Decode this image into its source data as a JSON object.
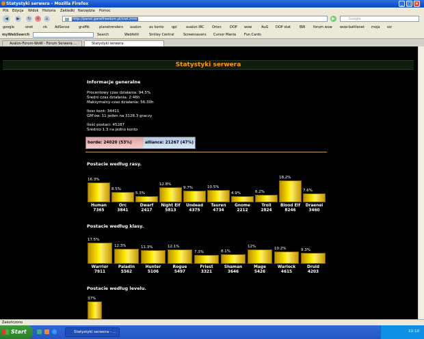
{
  "window": {
    "title": "Statystyki serwera - Mozilla Firefox"
  },
  "menu": [
    "Plik",
    "Edycja",
    "Widok",
    "Historia",
    "Zakładki",
    "Narzędzia",
    "Pomoc"
  ],
  "nav": {
    "url": "http://panel.ganefreedom.pl/stat.html",
    "search_placeholder": "Google"
  },
  "bookmarks": [
    "google",
    "onet",
    "nk",
    "AdSense",
    "graffik",
    "planetrenders",
    "avalon",
    "av konto",
    "qpl",
    "avalon IRC",
    "Orion",
    "DOP",
    "wow",
    "AuG",
    "DOP stat",
    "BW",
    "forum wow",
    "wow-battlenet",
    "moja",
    "ssr"
  ],
  "toolbar": {
    "brand": "myWebSearch",
    "items": [
      "Search",
      "Webfetti",
      "Smiley Central",
      "Screensavers",
      "Cursor Mania",
      "Fun Cards"
    ]
  },
  "tabs": [
    {
      "label": "Avalon-Forum-WoW - Forum Serwera ...",
      "active": false
    },
    {
      "label": "Statystyki serwera",
      "active": true
    }
  ],
  "page": {
    "header": "Statystyki serwera",
    "general_title": "Informacje generalne",
    "stats": [
      "Procentowy czas działania: 94.5%",
      "Średni czas działania: 2:46h",
      "Maksymalny czas działania: 56:30h",
      "Ilosc kont: 34411",
      "GM'ów: 11 jeden na 3128.3 graczy",
      "Ilość postaci: 45287",
      "Średnio 1.3 na jedno konto"
    ],
    "factions": {
      "horde": "horde: 24020 (53%)",
      "horde_pct": 53,
      "alliance": "alliance: 21267 (47%)"
    },
    "races_title": "Postacie według rasy.",
    "classes_title": "Postacie według klasy.",
    "levels_title": "Postacie według levelu."
  },
  "chart_data": [
    {
      "type": "bar",
      "title": "Postacie według rasy.",
      "categories": [
        "Human",
        "Orc",
        "Dwarf",
        "Night Elf",
        "Undead",
        "Tauren",
        "Gnome",
        "Troll",
        "Blood Elf",
        "Draenei"
      ],
      "values": [
        7365,
        3841,
        2417,
        5813,
        4375,
        4734,
        2212,
        2824,
        8246,
        3460
      ],
      "percent_labels": [
        "16.3%",
        "8.5%",
        "5.3%",
        "12.8%",
        "9.7%",
        "10.5%",
        "4.9%",
        "6.2%",
        "18.2%",
        "7.6%"
      ],
      "percents": [
        16.3,
        8.5,
        5.3,
        12.8,
        9.7,
        10.5,
        4.9,
        6.2,
        18.2,
        7.6
      ]
    },
    {
      "type": "bar",
      "title": "Postacie według klasy.",
      "categories": [
        "Warrior",
        "Paladin",
        "Hunter",
        "Rogue",
        "Priest",
        "Shaman",
        "Mage",
        "Warlock",
        "Druid"
      ],
      "values": [
        7911,
        5562,
        5106,
        5497,
        3321,
        3646,
        5426,
        4615,
        4203
      ],
      "percent_labels": [
        "17.5%",
        "12.3%",
        "11.3%",
        "12.1%",
        "7.3%",
        "8.1%",
        "12%",
        "10.2%",
        "9.3%"
      ],
      "percents": [
        17.5,
        12.3,
        11.3,
        12.1,
        7.3,
        8.1,
        12,
        10.2,
        9.3
      ]
    },
    {
      "type": "bar",
      "title": "Postacie według levelu.",
      "categories": [
        ""
      ],
      "percent_labels": [
        "37%"
      ],
      "percents": [
        37
      ]
    }
  ],
  "status": "Zakończono",
  "taskbar": {
    "start": "Start",
    "task": "Statystyki serwera - ...",
    "clock": "22:10"
  }
}
